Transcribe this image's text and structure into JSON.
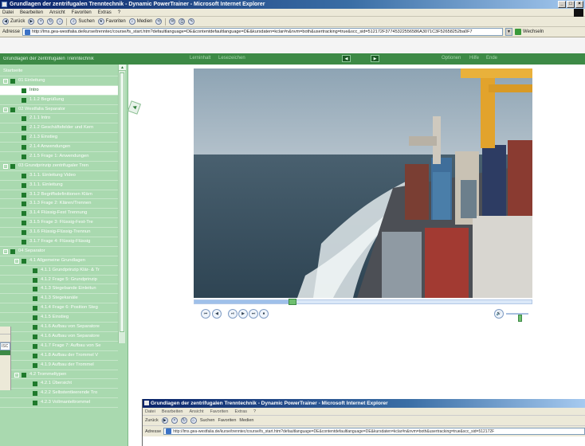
{
  "window": {
    "title": "Grundlagen der zentrifugalen Trenntechnik - Dynamic PowerTrainer - Microsoft Internet Explorer",
    "controls": [
      "_",
      "□",
      "×"
    ]
  },
  "menu": [
    "Datei",
    "Bearbeiten",
    "Ansicht",
    "Favoriten",
    "Extras",
    "?"
  ],
  "toolbar": {
    "back": "Zurück",
    "search": "Suchen",
    "favorites": "Favoriten",
    "media": "Medien"
  },
  "address": {
    "label": "Adresse",
    "url": "http://lms.gea-westfalia.de/kurse/trenntec/course/fs_start.htm?defaultlanguage=DE&contentdefaultlanguage=DE&kursdaten=kclar#n&nvm=both&usertracking=true&scc_sid=512172F37745322556586A3071C3F52658252ba0F7",
    "go": "Wechseln"
  },
  "app_header": {
    "course_title": "Grundlagen der zentrifugalen Trenntechnik",
    "nav_left": "Lerninhalt",
    "nav_left2": "Lesezeichen",
    "prev": "◀",
    "next": "▶",
    "nav_right": [
      "Optionen",
      "Hilfe",
      "Ende"
    ]
  },
  "tree": [
    {
      "label": "Startseite",
      "level": 0,
      "type": "plain"
    },
    {
      "label": "01 Einleitung",
      "level": 0,
      "type": "folder"
    },
    {
      "label": "Intro",
      "level": 1,
      "type": "page",
      "selected": true
    },
    {
      "label": "1.1.2 Begrüßung",
      "level": 1,
      "type": "page"
    },
    {
      "label": "02 Westfalia Separator",
      "level": 0,
      "type": "folder"
    },
    {
      "label": "2.1.1 Intro",
      "level": 1,
      "type": "page"
    },
    {
      "label": "2.1.2 Geschäftsfelder und Kern",
      "level": 1,
      "type": "page"
    },
    {
      "label": "2.1.3 Einstieg",
      "level": 1,
      "type": "page"
    },
    {
      "label": "2.1.4 Anwendungen",
      "level": 1,
      "type": "page"
    },
    {
      "label": "2.1.5 Frage 1: Anwendungen",
      "level": 1,
      "type": "page"
    },
    {
      "label": "03 Grundprinzip zentrifugaler Tren",
      "level": 0,
      "type": "folder"
    },
    {
      "label": "3.1.1. Einleitung Video",
      "level": 1,
      "type": "page"
    },
    {
      "label": "3.1.1. Einleitung",
      "level": 1,
      "type": "page"
    },
    {
      "label": "3.1.2 Begriffsdefinitionen Klärn",
      "level": 1,
      "type": "page"
    },
    {
      "label": "3.1.3 Frage 2: Klären/Trennen",
      "level": 1,
      "type": "page"
    },
    {
      "label": "3.1.4 Flüssig-Fest Trennung",
      "level": 1,
      "type": "page"
    },
    {
      "label": "3.1.5 Frage 3: Flüssig-Fest-Tre",
      "level": 1,
      "type": "page"
    },
    {
      "label": "3.1.6 Flüssig-Flüssig-Trennun",
      "level": 1,
      "type": "page"
    },
    {
      "label": "3.1.7 Frage 4: Flüssig-Flüssig",
      "level": 1,
      "type": "page"
    },
    {
      "label": "04 Separator",
      "level": 0,
      "type": "folder"
    },
    {
      "label": "4.1 Allgemeine Grundlagen",
      "level": 1,
      "type": "folder"
    },
    {
      "label": "4.1.1 Grundprinzip Klär- & Tr",
      "level": 2,
      "type": "page"
    },
    {
      "label": "4.1.2 Frage 5: Grundprinzip",
      "level": 2,
      "type": "page"
    },
    {
      "label": "4.1.3 Stegebande Einleitun",
      "level": 2,
      "type": "page"
    },
    {
      "label": "4.1.3 Stegekanäle",
      "level": 2,
      "type": "page"
    },
    {
      "label": "4.1.4 Frage 6: Position Steg",
      "level": 2,
      "type": "page"
    },
    {
      "label": "4.1.5 Einstieg",
      "level": 2,
      "type": "page"
    },
    {
      "label": "4.1.6 Aufbau von Separatore",
      "level": 2,
      "type": "page"
    },
    {
      "label": "4.1.6 Aufbau von Separatore",
      "level": 2,
      "type": "page"
    },
    {
      "label": "4.1.7 Frage 7: Aufbau von Se",
      "level": 2,
      "type": "page"
    },
    {
      "label": "4.1.8 Aufbau der Trommel V",
      "level": 2,
      "type": "page"
    },
    {
      "label": "4.1.9 Aufbau der Trommel",
      "level": 2,
      "type": "page"
    },
    {
      "label": "4.2 Trommeltypen",
      "level": 1,
      "type": "folder"
    },
    {
      "label": "4.2.1 Übersicht",
      "level": 2,
      "type": "page"
    },
    {
      "label": "4.2.2 Selbstentleerende Tro",
      "level": 2,
      "type": "page"
    },
    {
      "label": "4.2.3 Vollmanteltrommel",
      "level": 2,
      "type": "page"
    }
  ],
  "player": {
    "controls": [
      "⏮",
      "◀",
      "⏯",
      "▶",
      "⏭",
      "⏹",
      "🔊"
    ],
    "progress": 0.29,
    "volume": 0.6
  },
  "bg_window_left": {
    "text": "ISC"
  },
  "second_window": {
    "title": "Grundlagen der zentrifugalen Trenntechnik - Dynamic PowerTrainer - Microsoft Internet Explorer",
    "menu": [
      "Datei",
      "Bearbeiten",
      "Ansicht",
      "Favoriten",
      "Extras",
      "?"
    ],
    "toolbar": [
      "Zurück",
      "Suchen",
      "Favoriten",
      "Medien"
    ],
    "address_label": "Adresse",
    "url": "http://lms.gea-westfalia.de/kurse/trenntec/course/fs_start.htm?defaultlanguage=DE&contentdefaultlanguage=DE&kursdaten=kclar#n&nvm=both&usertracking=true&scc_sid=512172F"
  },
  "colors": {
    "green_header": "#3d8a46",
    "sidebar_green": "#a9d9af",
    "tree_bullet": "#1f7a2c",
    "title_blue": "#0a246a"
  }
}
